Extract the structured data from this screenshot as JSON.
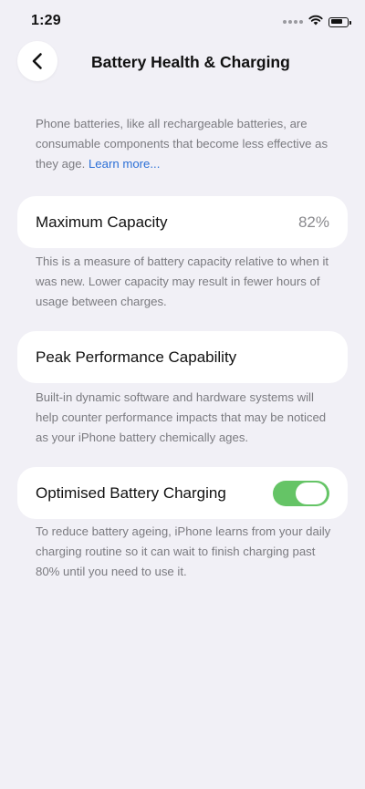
{
  "status_bar": {
    "time": "1:29"
  },
  "nav": {
    "title": "Battery Health & Charging"
  },
  "intro": {
    "text": "Phone batteries, like all rechargeable batteries, are consumable components that become less effective as they age.",
    "link": "Learn more..."
  },
  "maximum_capacity": {
    "label": "Maximum Capacity",
    "value": "82%",
    "description": "This is a measure of battery capacity relative to when it was new. Lower capacity may result in fewer hours of usage between charges."
  },
  "peak_performance": {
    "label": "Peak Performance Capability",
    "description": "Built-in dynamic software and hardware systems will help counter performance impacts that may be noticed as your iPhone battery chemically ages."
  },
  "optimised_charging": {
    "label": "Optimised Battery Charging",
    "enabled": true,
    "description": "To reduce battery ageing, iPhone learns from your daily charging routine so it can wait to finish charging past 80% until you need to use it."
  },
  "colors": {
    "background": "#f1f0f6",
    "toggle_on": "#65c466",
    "link": "#2b6fd6"
  },
  "icons": {
    "back": "chevron-left-icon",
    "wifi": "wifi-icon",
    "battery": "battery-icon",
    "signal": "signal-icon"
  }
}
